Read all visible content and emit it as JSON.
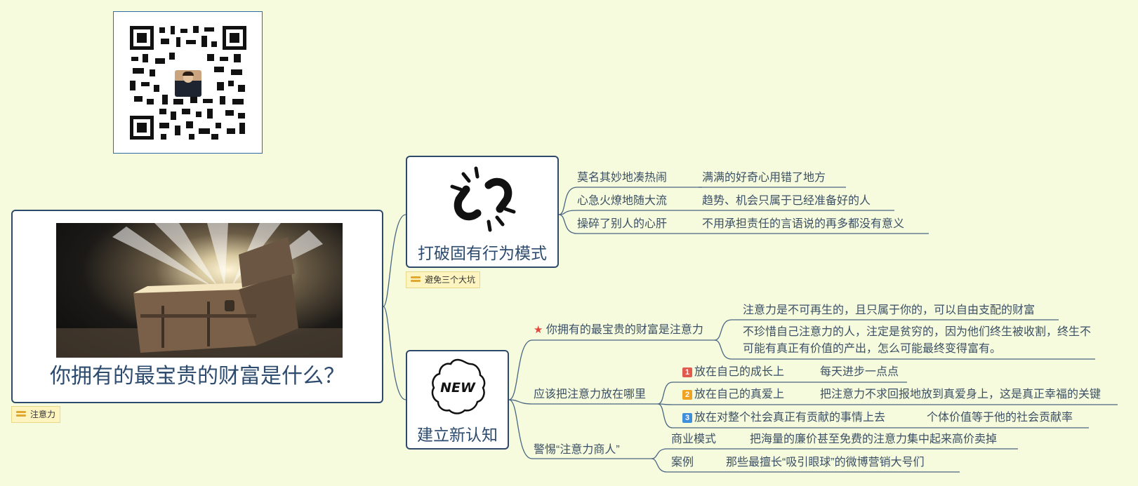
{
  "central": {
    "title": "你拥有的最宝贵的财富是什么？",
    "note": "注意力"
  },
  "branch1": {
    "title": "打破固有行为模式",
    "icon": "broken-link-icon",
    "note": "避免三个大坑",
    "items": [
      {
        "label": "莫名其妙地凑热闹",
        "detail": "满满的好奇心用错了地方"
      },
      {
        "label": "心急火燎地随大流",
        "detail": "趋势、机会只属于已经准备好的人"
      },
      {
        "label": "操碎了别人的心肝",
        "detail": "不用承担责任的言语说的再多都没有意义"
      }
    ]
  },
  "branch2": {
    "title": "建立新认知",
    "icon": "new-badge-icon",
    "icon_text": "NEW",
    "sub1": {
      "label": "你拥有的最宝贵的财富是注意力",
      "icon": "star-icon",
      "details": [
        "注意力是不可再生的，且只属于你的，可以自由支配的财富",
        "不珍惜自己注意力的人，注定是贫穷的，因为他们终生被收割，终生不可能有真正有价值的产出，怎么可能最终变得富有。"
      ]
    },
    "sub2": {
      "label": "应该把注意力放在哪里",
      "items": [
        {
          "num": "1",
          "color": "#e05a4f",
          "label": "放在自己的成长上",
          "detail": "每天进步一点点"
        },
        {
          "num": "2",
          "color": "#f0a323",
          "label": "放在自己的真爱上",
          "detail": "把注意力不求回报地放到真爱身上，这是真正幸福的关键"
        },
        {
          "num": "3",
          "color": "#3f8fdc",
          "label": "放在对整个社会真正有贡献的事情上去",
          "detail": "个体价值等于他的社会贡献率"
        }
      ]
    },
    "sub3": {
      "label": "警惕“注意力商人”",
      "items": [
        {
          "label": "商业模式",
          "detail": "把海量的廉价甚至免费的注意力集中起来高价卖掉"
        },
        {
          "label": "案例",
          "detail": "那些最擅长“吸引眼球”的微博营销大号们"
        }
      ]
    }
  },
  "qr": {
    "icon": "qr-code-icon",
    "avatar": "avatar-icon"
  },
  "colors": {
    "background": "#f5fbdc",
    "line": "#4a6584",
    "node_border": "#2e4a6b"
  }
}
